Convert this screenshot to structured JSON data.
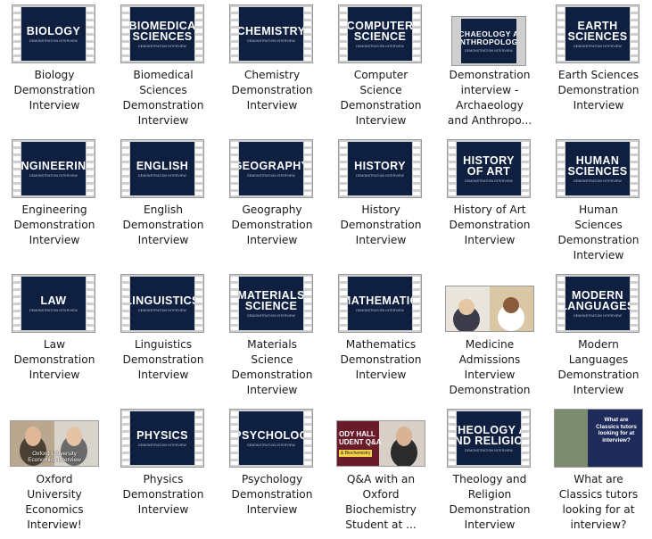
{
  "items": [
    {
      "caption": [
        "Biology",
        "Demonstration",
        "Interview"
      ],
      "thumb": {
        "kind": "title",
        "lines": [
          "BIOLOGY"
        ],
        "sub": "DEMONSTRATION INTERVIEW"
      }
    },
    {
      "caption": [
        "Biomedical",
        "Sciences",
        "Demonstration",
        "Interview"
      ],
      "thumb": {
        "kind": "title",
        "lines": [
          "BIOMEDICA",
          "SCIENCES"
        ],
        "sub": "DEMONSTRATION INTERVIEW"
      }
    },
    {
      "caption": [
        "Chemistry",
        "Demonstration",
        "Interview"
      ],
      "thumb": {
        "kind": "title",
        "lines": [
          "CHEMISTRY"
        ],
        "sub": "DEMONSTRATION INTERVIEW"
      }
    },
    {
      "caption": [
        "Computer",
        "Science",
        "Demonstration",
        "Interview"
      ],
      "thumb": {
        "kind": "title",
        "lines": [
          "COMPUTER",
          "SCIENCE"
        ],
        "sub": "DEMONSTRATION INTERVIEW"
      }
    },
    {
      "caption": [
        "Demonstration",
        "interview -",
        "Archaeology",
        "and Anthropo..."
      ],
      "thumb": {
        "kind": "title",
        "lines": [
          "ARCHAEOLOGY AND",
          "ANTHROPOLOGY"
        ],
        "sub": "DEMONSTRATION INTERVIEW",
        "small": true,
        "noholes": true
      }
    },
    {
      "caption": [
        "Earth Sciences",
        "Demonstration",
        "Interview"
      ],
      "thumb": {
        "kind": "title",
        "lines": [
          "EARTH",
          "SCIENCES"
        ],
        "sub": "DEMONSTRATION INTERVIEW"
      }
    },
    {
      "caption": [
        "Engineering",
        "Demonstration",
        "Interview"
      ],
      "thumb": {
        "kind": "title",
        "lines": [
          "NGINEERIN"
        ],
        "sub": "DEMONSTRATION INTERVIEW"
      }
    },
    {
      "caption": [
        "English",
        "Demonstration",
        "Interview"
      ],
      "thumb": {
        "kind": "title",
        "lines": [
          "ENGLISH"
        ],
        "sub": "DEMONSTRATION INTERVIEW"
      }
    },
    {
      "caption": [
        "Geography",
        "Demonstration",
        "Interview"
      ],
      "thumb": {
        "kind": "title",
        "lines": [
          "GEOGRAPHY"
        ],
        "sub": "DEMONSTRATION INTERVIEW"
      }
    },
    {
      "caption": [
        "History",
        "Demonstration",
        "Interview"
      ],
      "thumb": {
        "kind": "title",
        "lines": [
          "HISTORY"
        ],
        "sub": "DEMONSTRATION INTERVIEW"
      }
    },
    {
      "caption": [
        "History of Art",
        "Demonstration",
        "Interview"
      ],
      "thumb": {
        "kind": "title",
        "lines": [
          "HISTORY",
          "OF ART"
        ],
        "sub": "DEMONSTRATION INTERVIEW"
      }
    },
    {
      "caption": [
        "Human",
        "Sciences",
        "Demonstration",
        "Interview"
      ],
      "thumb": {
        "kind": "title",
        "lines": [
          "HUMAN",
          "SCIENCES"
        ],
        "sub": "DEMONSTRATION INTERVIEW"
      }
    },
    {
      "caption": [
        "Law",
        "Demonstration",
        "Interview"
      ],
      "thumb": {
        "kind": "title",
        "lines": [
          "LAW"
        ],
        "sub": "DEMONSTRATION INTERVIEW"
      }
    },
    {
      "caption": [
        "Linguistics",
        "Demonstration",
        "Interview"
      ],
      "thumb": {
        "kind": "title",
        "lines": [
          "LINGUISTICS"
        ],
        "sub": "DEMONSTRATION INTERVIEW"
      }
    },
    {
      "caption": [
        "Materials",
        "Science",
        "Demonstration",
        "Interview"
      ],
      "thumb": {
        "kind": "title",
        "lines": [
          "MATERIALS",
          "SCIENCE"
        ],
        "sub": "DEMONSTRATION INTERVIEW"
      }
    },
    {
      "caption": [
        "Mathematics",
        "Demonstration",
        "Interview"
      ],
      "thumb": {
        "kind": "title",
        "lines": [
          "MATHEMATIC"
        ],
        "sub": "DEMONSTRATION INTERVIEW"
      }
    },
    {
      "caption": [
        "Medicine",
        "Admissions",
        "Interview",
        "Demonstration"
      ],
      "thumb": {
        "kind": "medicine"
      }
    },
    {
      "caption": [
        "Modern",
        "Languages",
        "Demonstration",
        "Interview"
      ],
      "thumb": {
        "kind": "title",
        "lines": [
          "MODERN",
          "LANGUAGES"
        ],
        "sub": "DEMONSTRATION INTERVIEW"
      }
    },
    {
      "caption": [
        "Oxford",
        "University",
        "Economics",
        "Interview!"
      ],
      "thumb": {
        "kind": "economics",
        "overlay": [
          "Oxford University",
          "Economics Interview"
        ]
      }
    },
    {
      "caption": [
        "Physics",
        "Demonstration",
        "Interview"
      ],
      "thumb": {
        "kind": "title",
        "lines": [
          "PHYSICS"
        ],
        "sub": "DEMONSTRATION INTERVIEW"
      }
    },
    {
      "caption": [
        "Psychology",
        "Demonstration",
        "Interview"
      ],
      "thumb": {
        "kind": "title",
        "lines": [
          "PSYCHOLOG"
        ],
        "sub": "DEMONSTRATION INTERVIEW"
      }
    },
    {
      "caption": [
        "Q&A with an",
        "Oxford",
        "Biochemistry",
        "Student at ..."
      ],
      "thumb": {
        "kind": "qa",
        "lines": [
          "ODY HALL",
          "UDENT Q&A"
        ],
        "tag": "& Biochemistry"
      }
    },
    {
      "caption": [
        "Theology and",
        "Religion",
        "Demonstration",
        "Interview"
      ],
      "thumb": {
        "kind": "title",
        "lines": [
          "THEOLOGY A",
          "ND RELIGIO"
        ],
        "sub": "DEMONSTRATION INTERVIEW"
      }
    },
    {
      "caption": [
        "What are",
        "Classics tutors",
        "looking for at",
        "interview?"
      ],
      "thumb": {
        "kind": "classics",
        "lines": [
          "What are",
          "Classics tutors",
          "looking for at",
          "interview?"
        ]
      }
    }
  ]
}
